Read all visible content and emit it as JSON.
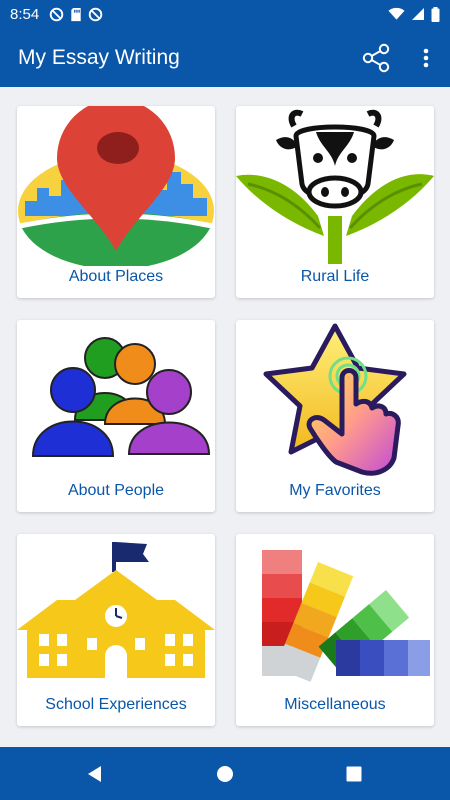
{
  "status_bar": {
    "time": "8:54",
    "left_icons": [
      "do-not-disturb-icon",
      "sd-card-icon",
      "do-not-disturb-icon"
    ],
    "right_icons": [
      "wifi-icon",
      "cell-signal-icon",
      "battery-icon"
    ]
  },
  "app_bar": {
    "title": "My Essay Writing",
    "share_icon": "share-icon",
    "more_icon": "more-vert-icon"
  },
  "categories": [
    {
      "label": "About Places",
      "icon": "map-pin-city-icon"
    },
    {
      "label": "Rural Life",
      "icon": "cow-plant-icon"
    },
    {
      "label": "About People",
      "icon": "people-group-icon"
    },
    {
      "label": "My Favorites",
      "icon": "star-tap-icon"
    },
    {
      "label": "School Experiences",
      "icon": "school-building-icon"
    },
    {
      "label": "Miscellaneous",
      "icon": "color-swatch-icon"
    }
  ],
  "nav_bar": {
    "icons": [
      "back-icon",
      "home-icon",
      "recents-icon"
    ]
  },
  "colors": {
    "primary": "#0a56a8",
    "background": "#eef0f3",
    "card": "#ffffff",
    "label": "#0a56a8"
  }
}
